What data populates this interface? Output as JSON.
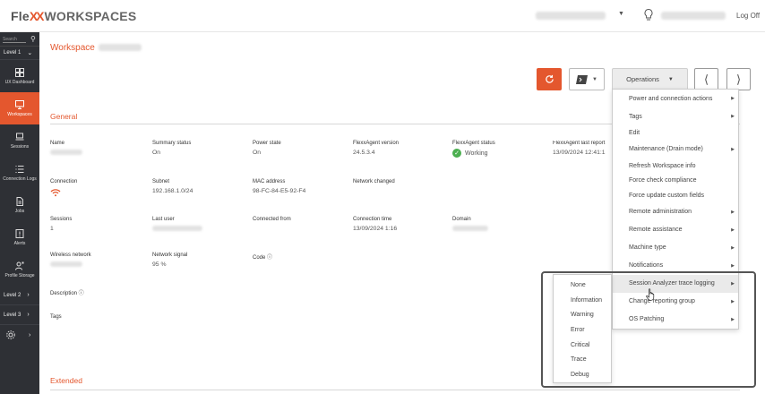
{
  "header": {
    "brand_fle": "Fle",
    "brand_xx": "XX",
    "brand_workspaces": "WORKSPACES",
    "logoff": "Log Off"
  },
  "sidebar": {
    "search_placeholder": "Search",
    "level1": "Level 1",
    "items": [
      {
        "label": "UX Dashboard",
        "icon": "dashboard-icon"
      },
      {
        "label": "Workspaces",
        "icon": "monitor-icon"
      },
      {
        "label": "Sessions",
        "icon": "sessions-icon"
      },
      {
        "label": "Connection Logs",
        "icon": "list-icon"
      },
      {
        "label": "Jobs",
        "icon": "document-icon"
      },
      {
        "label": "Alerts",
        "icon": "alert-icon"
      },
      {
        "label": "Profile Storage",
        "icon": "user-storage-icon"
      }
    ],
    "level2": "Level 2",
    "level3": "Level 3"
  },
  "breadcrumb": "Workspace",
  "toolbar": {
    "operations": "Operations"
  },
  "general": {
    "title": "General",
    "fields": {
      "name": {
        "label": "Name"
      },
      "summary_status": {
        "label": "Summary status",
        "value": "On"
      },
      "power_state": {
        "label": "Power state",
        "value": "On"
      },
      "agent_version": {
        "label": "FlexxAgent version",
        "value": "24.5.3.4"
      },
      "agent_status": {
        "label": "FlexxAgent status",
        "value": "Working"
      },
      "agent_last_report": {
        "label": "FlexxAgent last report",
        "value": "13/09/2024 12:41:1"
      },
      "connection": {
        "label": "Connection"
      },
      "subnet": {
        "label": "Subnet",
        "value": "192.168.1.0/24"
      },
      "mac": {
        "label": "MAC address",
        "value": "98-FC-84-E5-92-F4"
      },
      "network_changed": {
        "label": "Network changed"
      },
      "sessions": {
        "label": "Sessions",
        "value": "1"
      },
      "last_user": {
        "label": "Last user"
      },
      "connected_from": {
        "label": "Connected from"
      },
      "connection_time": {
        "label": "Connection time",
        "value": "13/09/2024 1:16"
      },
      "domain": {
        "label": "Domain"
      },
      "wireless_network": {
        "label": "Wireless network"
      },
      "network_signal": {
        "label": "Network signal",
        "value": "95 %"
      },
      "code": {
        "label": "Code ⓘ"
      },
      "description": {
        "label": "Description ⓘ"
      },
      "tags": {
        "label": "Tags"
      }
    }
  },
  "extended": {
    "title": "Extended"
  },
  "operations_menu": [
    {
      "label": "Power and connection actions",
      "submenu": true
    },
    {
      "label": "Tags",
      "submenu": true
    },
    {
      "label": "Edit",
      "submenu": false
    },
    {
      "label": "Maintenance (Drain mode)",
      "submenu": true
    },
    {
      "label": "Refresh Workspace info",
      "submenu": false
    },
    {
      "label": "Force check compliance",
      "submenu": false
    },
    {
      "label": "Force update custom fields",
      "submenu": false
    },
    {
      "label": "Remote administration",
      "submenu": true
    },
    {
      "label": "Remote assistance",
      "submenu": true
    },
    {
      "label": "Machine type",
      "submenu": true
    },
    {
      "label": "Notifications",
      "submenu": true
    },
    {
      "label": "Session Analyzer trace logging",
      "submenu": true,
      "highlighted": true
    },
    {
      "label": "Change reporting group",
      "submenu": true
    },
    {
      "label": "OS Patching",
      "submenu": true
    }
  ],
  "trace_submenu": [
    "None",
    "Information",
    "Warning",
    "Error",
    "Critical",
    "Trace",
    "Debug"
  ],
  "colors": {
    "accent": "#e4572e",
    "sidebar_bg": "#2e3035",
    "ok": "#4caf50"
  }
}
